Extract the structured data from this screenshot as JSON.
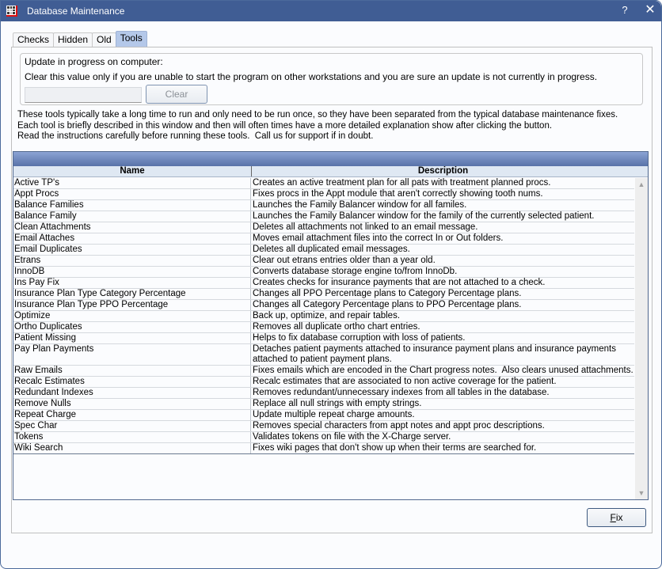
{
  "window": {
    "title": "Database Maintenance",
    "help_label": "?",
    "close_label": "✕"
  },
  "tabs": [
    {
      "label": "Checks",
      "active": false
    },
    {
      "label": "Hidden",
      "active": false
    },
    {
      "label": "Old",
      "active": false
    },
    {
      "label": "Tools",
      "active": true
    }
  ],
  "update_group": {
    "title": "Update in progress on computer:",
    "description": "Clear this value only if you are unable to start the program on other workstations and you are sure an update is not currently in progress.",
    "input_value": "",
    "clear_label": "Clear"
  },
  "info_text": "These tools typically take a long time to run and only need to be run once, so they have been separated from the typical database maintenance fixes.\nEach tool is briefly described in this window and then will often times have a more detailed explanation show after clicking the button.\nRead the instructions carefully before running these tools.  Call us for support if in doubt.",
  "grid": {
    "title": "",
    "columns": [
      "Name",
      "Description"
    ],
    "rows": [
      {
        "name": "Active TP's",
        "description": "Creates an active treatment plan for all pats with treatment planned procs."
      },
      {
        "name": "Appt Procs",
        "description": "Fixes procs in the Appt module that aren't correctly showing tooth nums."
      },
      {
        "name": "Balance Families",
        "description": "Launches the Family Balancer window for all familes."
      },
      {
        "name": "Balance Family",
        "description": "Launches the Family Balancer window for the family of the currently selected patient."
      },
      {
        "name": "Clean Attachments",
        "description": "Deletes all attachments not linked to an email message."
      },
      {
        "name": "Email Attaches",
        "description": "Moves email attachment files into the correct In or Out folders."
      },
      {
        "name": "Email Duplicates",
        "description": "Deletes all duplicated email messages."
      },
      {
        "name": "Etrans",
        "description": "Clear out etrans entries older than a year old."
      },
      {
        "name": "InnoDB",
        "description": "Converts database storage engine to/from InnoDb."
      },
      {
        "name": "Ins Pay Fix",
        "description": "Creates checks for insurance payments that are not attached to a check."
      },
      {
        "name": "Insurance Plan Type Category Percentage",
        "description": "Changes all PPO Percentage plans to Category Percentage plans."
      },
      {
        "name": "Insurance Plan Type PPO Percentage",
        "description": "Changes all Category Percentage plans to PPO Percentage plans."
      },
      {
        "name": "Optimize",
        "description": "Back up, optimize, and repair tables."
      },
      {
        "name": "Ortho Duplicates",
        "description": "Removes all duplicate ortho chart entries."
      },
      {
        "name": "Patient Missing",
        "description": "Helps to fix database corruption with loss of patients."
      },
      {
        "name": "Pay Plan Payments",
        "description": "Detaches patient payments attached to insurance payment plans and insurance payments\nattached to patient payment plans."
      },
      {
        "name": "Raw Emails",
        "description": "Fixes emails which are encoded in the Chart progress notes.  Also clears unused attachments."
      },
      {
        "name": "Recalc Estimates",
        "description": "Recalc estimates that are associated to non active coverage for the patient."
      },
      {
        "name": "Redundant Indexes",
        "description": "Removes redundant/unnecessary indexes from all tables in the database."
      },
      {
        "name": "Remove Nulls",
        "description": "Replace all null strings with empty strings."
      },
      {
        "name": "Repeat Charge",
        "description": "Update multiple repeat charge amounts."
      },
      {
        "name": "Spec Char",
        "description": "Removes special characters from appt notes and appt proc descriptions."
      },
      {
        "name": "Tokens",
        "description": "Validates tokens on file with the X-Charge server."
      },
      {
        "name": "Wiki Search",
        "description": "Fixes wiki pages that don't show up when their terms are searched for."
      }
    ],
    "scroll_up_icon": "▲",
    "scroll_down_icon": "▼"
  },
  "fix_button": {
    "mnemonic": "F",
    "rest": "ix"
  },
  "colors": {
    "titlebar": "#405d94",
    "active_tab": "#b4c8e9",
    "grid_title_top": "#8ba3d4",
    "grid_title_bottom": "#5872a8",
    "grid_header": "#dfe8f3"
  }
}
